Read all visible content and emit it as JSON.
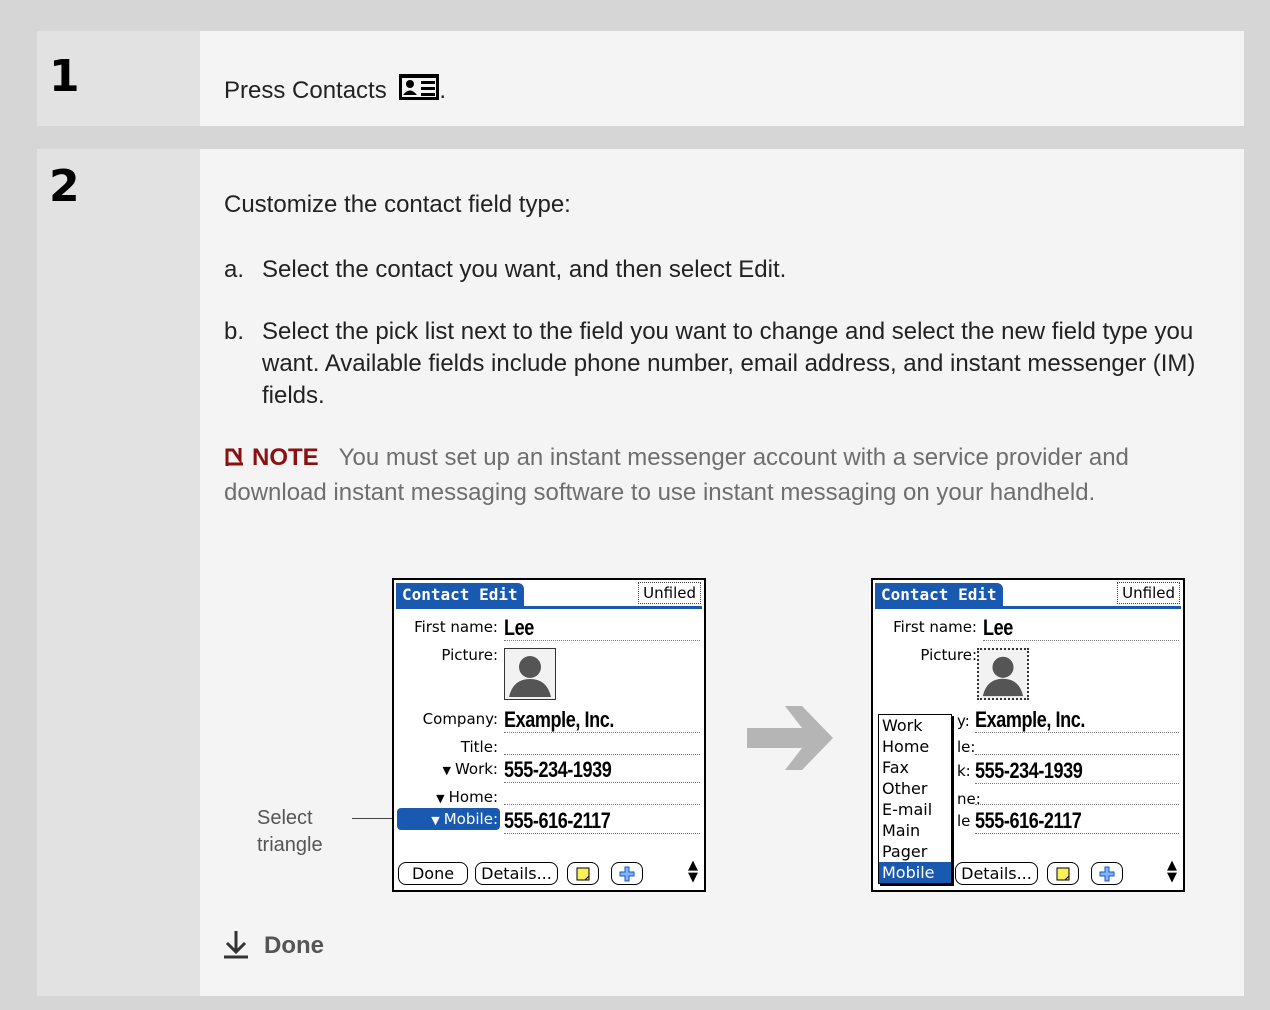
{
  "steps": [
    {
      "number": "1",
      "text_prefix": "Press Contacts",
      "text_suffix": "."
    },
    {
      "number": "2",
      "intro": "Customize the contact field type:",
      "items": [
        {
          "label": "a.",
          "text": "Select the contact you want, and then select Edit."
        },
        {
          "label": "b.",
          "text": "Select the pick list next to the field you want to change and select the new field type you want. Available fields include phone number, email address, and instant messenger (IM) fields."
        }
      ]
    }
  ],
  "note": {
    "label": "NOTE",
    "text": "You must set up an instant messenger account with a service provider and download instant messaging software to use instant messaging on your handheld."
  },
  "callout": {
    "line1": "Select",
    "line2": "triangle"
  },
  "done_label": "Done",
  "screen_left": {
    "title": "Contact Edit",
    "category": "Unfiled",
    "fields": {
      "first_name_label": "First name:",
      "first_name_value": "Lee",
      "picture_label": "Picture:",
      "company_label": "Company:",
      "company_value": "Example, Inc.",
      "title_label": "Title:",
      "work_label": "Work:",
      "work_value": "555-234-1939",
      "home_label": "Home:",
      "mobile_label": "Mobile:",
      "mobile_value": "555-616-2117"
    },
    "buttons": {
      "done": "Done",
      "details": "Details..."
    }
  },
  "screen_right": {
    "title": "Contact Edit",
    "category": "Unfiled",
    "fields": {
      "first_name_label": "First name:",
      "first_name_value": "Lee",
      "picture_label": "Picture:",
      "company_label_partial": "y:",
      "company_value": "Example, Inc.",
      "title_label_partial": "le:",
      "work_label_partial": "k:",
      "work_value": "555-234-1939",
      "home_label_partial": "ne:",
      "mobile_label_partial": "le",
      "mobile_value": "555-616-2117"
    },
    "popup_items": [
      "Work",
      "Home",
      "Fax",
      "Other",
      "E-mail",
      "Main",
      "Pager",
      "Mobile"
    ],
    "selected_popup_item": "Mobile",
    "buttons": {
      "details": "Details..."
    }
  },
  "icons": {
    "contacts": "contacts-icon",
    "note": "note-icon",
    "done": "down-arrow-done-icon",
    "arrow": "right-arrow-icon"
  },
  "colors": {
    "accent_blue": "#1a59b0",
    "note_red": "#8a1111",
    "arrow_gray": "#b5b5b5"
  }
}
